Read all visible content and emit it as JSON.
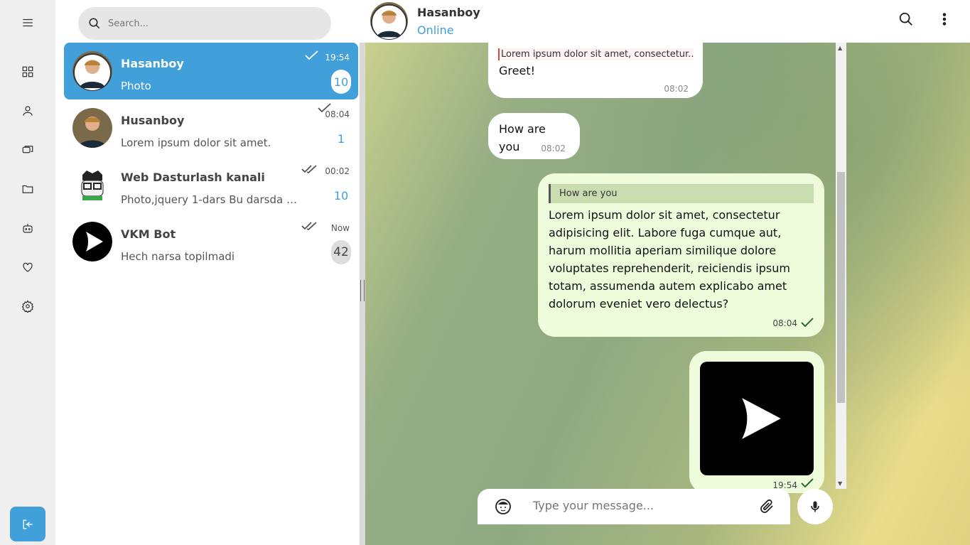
{
  "search": {
    "placeholder": "Search..."
  },
  "rail": {
    "items": [
      "menu-icon",
      "dashboard-icon",
      "user-icon",
      "chats-icon",
      "folder-icon",
      "bot-icon",
      "heart-icon",
      "settings-icon"
    ],
    "logout": "logout-icon"
  },
  "chats": [
    {
      "name": "Hasanboy",
      "message": "Photo",
      "time": "19:54",
      "badge": "10",
      "check": "single"
    },
    {
      "name": "Husanboy",
      "message": "Lorem ipsum dolor sit amet.",
      "time": "08:04",
      "badge": "1",
      "check": "single"
    },
    {
      "name": "Web Dasturlash kanali",
      "message": "Photo,jquery 1-dars Bu darsda …",
      "time": "00:02",
      "badge": "10",
      "check": "double"
    },
    {
      "name": "VKM Bot",
      "message": "Hech narsa topilmadi",
      "time": "Now",
      "badge": "42",
      "check": "double"
    }
  ],
  "header": {
    "name": "Hasanboy",
    "status": "Online"
  },
  "messages": [
    {
      "quote": "Lorem ipsum dolor sit amet, consectetur...",
      "text": "Greet!",
      "time": "08:02"
    },
    {
      "text": "How are you",
      "time": "08:02"
    },
    {
      "quote": "How are you",
      "text": "Lorem ipsum dolor sit amet, consectetur adipisicing elit. Labore fuga cumque aut, harum mollitia aperiam similique dolore voluptates reprehenderit, reiciendis ipsum totam, assumenda autem explicabo amet dolorum eveniet vero delectus?",
      "time": "08:04"
    },
    {
      "media": "play-logo",
      "time": "19:54"
    }
  ],
  "composer": {
    "placeholder": "Type your message..."
  },
  "colors": {
    "accent": "#419fd9",
    "outgoing": "#eefcdc"
  }
}
